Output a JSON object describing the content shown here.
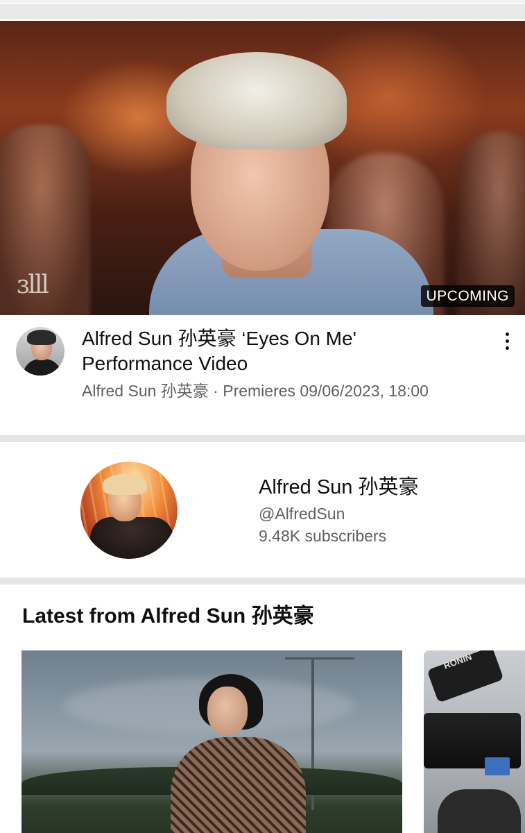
{
  "featured_video": {
    "logo_mark": "ɜlll",
    "badge": "UPCOMING",
    "title": "Alfred Sun 孙英豪 ‘Eyes On Me' Performance Video",
    "meta": "Alfred Sun 孙英豪 · Premieres 09/06/2023, 18:00"
  },
  "channel": {
    "name": "Alfred Sun 孙英豪",
    "handle": "@AlfredSun",
    "subscribers": "9.48K subscribers"
  },
  "latest": {
    "title": "Latest from Alfred Sun 孙英豪",
    "second_card_label": "RONIN"
  },
  "colors": {
    "text_primary": "#0f0f0f",
    "text_secondary": "#606060",
    "separator": "#e5e5e5",
    "badge_bg": "#000000cc"
  }
}
